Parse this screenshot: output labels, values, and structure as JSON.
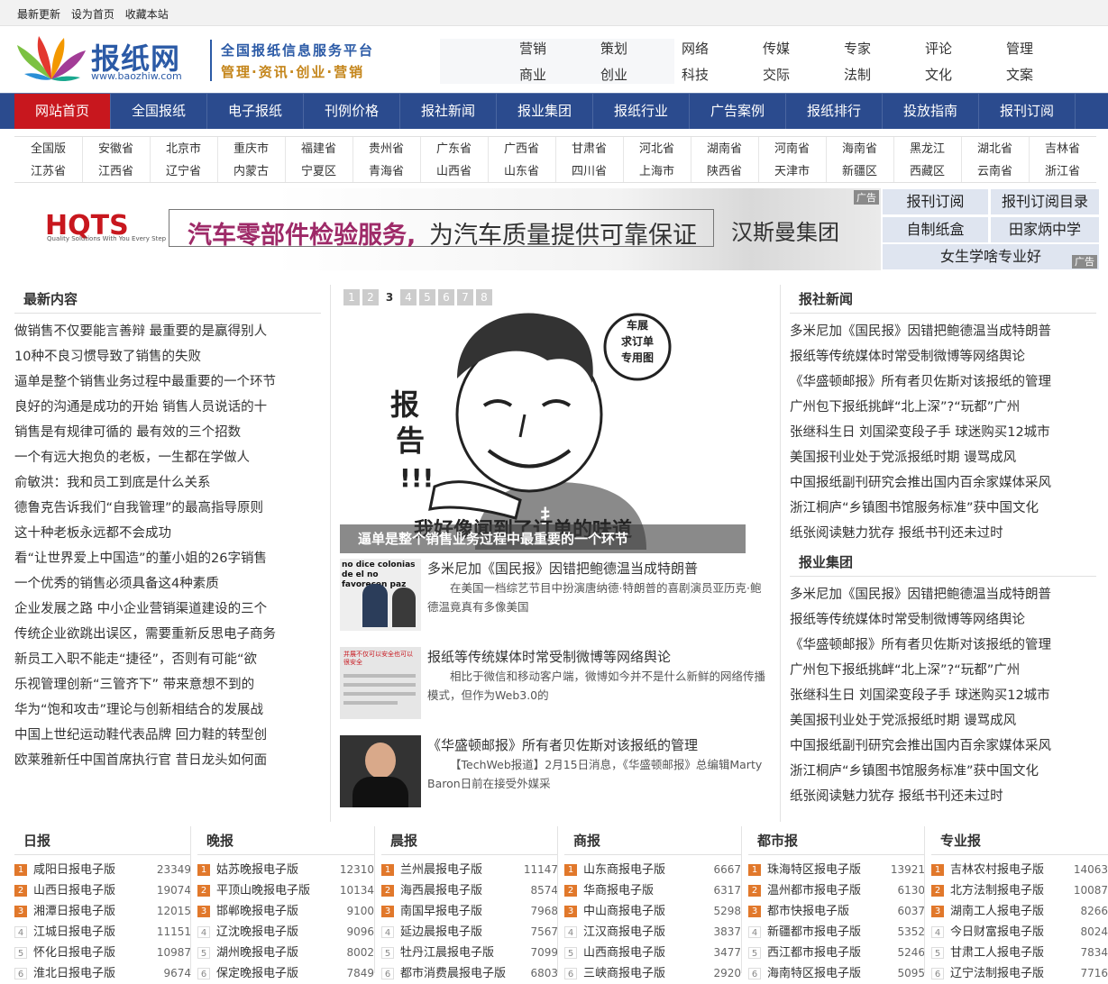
{
  "topbar": {
    "links": [
      "最新更新",
      "设为首页",
      "收藏本站"
    ]
  },
  "logo": {
    "name": "报纸网",
    "url": "www.baozhiw.com"
  },
  "slogan": {
    "line1": "全国报纸信息服务平台",
    "line2": "管理·资讯·创业·营销"
  },
  "topcats": [
    [
      "营销",
      "策划",
      "网络",
      "传媒",
      "专家",
      "评论",
      "管理"
    ],
    [
      "商业",
      "创业",
      "科技",
      "交际",
      "法制",
      "文化",
      "文案"
    ]
  ],
  "nav": [
    "网站首页",
    "全国报纸",
    "电子报纸",
    "刊例价格",
    "报社新闻",
    "报业集团",
    "报纸行业",
    "广告案例",
    "报纸排行",
    "投放指南",
    "报刊订阅"
  ],
  "regions": [
    [
      "全国版",
      "安徽省",
      "北京市",
      "重庆市",
      "福建省",
      "贵州省",
      "广东省",
      "广西省",
      "甘肃省",
      "河北省",
      "湖南省",
      "河南省",
      "海南省",
      "黑龙江",
      "湖北省",
      "吉林省"
    ],
    [
      "江苏省",
      "江西省",
      "辽宁省",
      "内蒙古",
      "宁夏区",
      "青海省",
      "山西省",
      "山东省",
      "四川省",
      "上海市",
      "陕西省",
      "天津市",
      "新疆区",
      "西藏区",
      "云南省",
      "浙江省"
    ]
  ],
  "banner": {
    "brand": "HQTS",
    "brand_sub": "Quality Solutions With You Every Step",
    "text1": "汽车零部件检验服务,",
    "text2": "为汽车质量提供可靠保证",
    "text3": "汉斯曼集团",
    "ad": "广告"
  },
  "sidead": {
    "items": [
      "报刊订阅",
      "报刊订阅目录",
      "自制纸盒",
      "田家炳中学",
      "女生学啥专业好"
    ],
    "ad": "广告"
  },
  "left": {
    "title": "最新内容",
    "items": [
      "做销售不仅要能言善辩 最重要的是赢得别人",
      "10种不良习惯导致了销售的失败",
      "逼单是整个销售业务过程中最重要的一个环节",
      "良好的沟通是成功的开始 销售人员说话的十",
      "销售是有规律可循的 最有效的三个招数",
      "一个有远大抱负的老板，一生都在学做人",
      "俞敏洪：我和员工到底是什么关系",
      "德鲁克告诉我们“自我管理”的最高指导原则",
      "这十种老板永远都不会成功",
      "看“让世界爱上中国造”的董小姐的26字销售",
      "一个优秀的销售必须具备这4种素质",
      "企业发展之路 中小企业营销渠道建设的三个",
      "传统企业欲跳出误区，需要重新反思电子商务",
      "新员工入职不能走“捷径”，否则有可能“欲",
      "乐视管理创新“三管齐下” 带来意想不到的",
      "华为“饱和攻击”理论与创新相结合的发展战",
      "中国上世纪运动鞋代表品牌 回力鞋的转型创",
      "欧莱雅新任中国首席执行官 昔日龙头如何面"
    ]
  },
  "slider": {
    "pages": [
      "1",
      "2",
      "3",
      "4",
      "5",
      "6",
      "7",
      "8"
    ],
    "current": "3",
    "caption": "逼单是整个销售业务过程中最重要的一个环节",
    "img_badge": "车展\n求订单\n专用图",
    "img_left": "报告!!!",
    "img_bottom": "我好像闻到了订单的味道",
    "shirt": "扌"
  },
  "news": [
    {
      "title": "多米尼加《国民报》因错把鲍德温当成特朗普",
      "summary": "在美国一档综艺节目中扮演唐纳德·特朗普的喜剧演员亚历克·鲍德温竟真有多像美国",
      "img_text": "no dice colonias de el no favorecen paz"
    },
    {
      "title": "报纸等传统媒体时常受制微博等网络舆论",
      "summary": "相比于微信和移动客户端，微博如今并不是什么新鲜的网络传播模式，但作为Web3.0的",
      "img_text": "并展不仅可以安全也可以很安全"
    },
    {
      "title": "《华盛顿邮报》所有者贝佐斯对该报纸的管理",
      "summary": "【TechWeb报道】2月15日消息，《华盛顿邮报》总编辑Marty Baron日前在接受外媒采",
      "img_text": ""
    }
  ],
  "right": {
    "title1": "报社新闻",
    "items1": [
      "多米尼加《国民报》因错把鲍德温当成特朗普",
      "报纸等传统媒体时常受制微博等网络舆论",
      "《华盛顿邮报》所有者贝佐斯对该报纸的管理",
      "广州包下报纸挑衅“北上深”?“玩都”广州",
      "张继科生日 刘国梁变段子手 球迷购买12城市",
      "美国报刊业处于党派报纸时期 谩骂成风",
      "中国报纸副刊研究会推出国内百余家媒体采风",
      "浙江桐庐“乡镇图书馆服务标准”获中国文化",
      "纸张阅读魅力犹存 报纸书刊还未过时"
    ],
    "title2": "报业集团",
    "items2": [
      "多米尼加《国民报》因错把鲍德温当成特朗普",
      "报纸等传统媒体时常受制微博等网络舆论",
      "《华盛顿邮报》所有者贝佐斯对该报纸的管理",
      "广州包下报纸挑衅“北上深”?“玩都”广州",
      "张继科生日 刘国梁变段子手 球迷购买12城市",
      "美国报刊业处于党派报纸时期 谩骂成风",
      "中国报纸副刊研究会推出国内百余家媒体采风",
      "浙江桐庐“乡镇图书馆服务标准”获中国文化",
      "纸张阅读魅力犹存 报纸书刊还未过时"
    ]
  },
  "rankings": [
    {
      "title": "日报",
      "rows": [
        [
          "1",
          "咸阳日报电子版",
          "23349"
        ],
        [
          "2",
          "山西日报电子版",
          "19074"
        ],
        [
          "3",
          "湘潭日报电子版",
          "12015"
        ],
        [
          "4",
          "江城日报电子版",
          "11151"
        ],
        [
          "5",
          "怀化日报电子版",
          "10987"
        ],
        [
          "6",
          "淮北日报电子版",
          "9674"
        ]
      ]
    },
    {
      "title": "晚报",
      "rows": [
        [
          "1",
          "姑苏晚报电子版",
          "12310"
        ],
        [
          "2",
          "平顶山晚报电子版",
          "10134"
        ],
        [
          "3",
          "邯郸晚报电子版",
          "9100"
        ],
        [
          "4",
          "辽沈晚报电子版",
          "9096"
        ],
        [
          "5",
          "湖州晚报电子版",
          "8002"
        ],
        [
          "6",
          "保定晚报电子版",
          "7849"
        ]
      ]
    },
    {
      "title": "晨报",
      "rows": [
        [
          "1",
          "兰州晨报电子版",
          "11147"
        ],
        [
          "2",
          "海西晨报电子版",
          "8574"
        ],
        [
          "3",
          "南国早报电子版",
          "7968"
        ],
        [
          "4",
          "延边晨报电子版",
          "7567"
        ],
        [
          "5",
          "牡丹江晨报电子版",
          "7099"
        ],
        [
          "6",
          "都市消费晨报电子版",
          "6803"
        ]
      ]
    },
    {
      "title": "商报",
      "rows": [
        [
          "1",
          "山东商报电子版",
          "6667"
        ],
        [
          "2",
          "华商报电子版",
          "6317"
        ],
        [
          "3",
          "中山商报电子版",
          "5298"
        ],
        [
          "4",
          "江汉商报电子版",
          "3837"
        ],
        [
          "5",
          "山西商报电子版",
          "3477"
        ],
        [
          "6",
          "三峡商报电子版",
          "2920"
        ]
      ]
    },
    {
      "title": "都市报",
      "rows": [
        [
          "1",
          "珠海特区报电子版",
          "13921"
        ],
        [
          "2",
          "温州都市报电子版",
          "6130"
        ],
        [
          "3",
          "都市快报电子版",
          "6037"
        ],
        [
          "4",
          "新疆都市报电子版",
          "5352"
        ],
        [
          "5",
          "西江都市报电子版",
          "5246"
        ],
        [
          "6",
          "海南特区报电子版",
          "5095"
        ]
      ]
    },
    {
      "title": "专业报",
      "rows": [
        [
          "1",
          "吉林农村报电子版",
          "14063"
        ],
        [
          "2",
          "北方法制报电子版",
          "10087"
        ],
        [
          "3",
          "湖南工人报电子版",
          "8266"
        ],
        [
          "4",
          "今日财富报电子版",
          "8024"
        ],
        [
          "5",
          "甘肃工人报电子版",
          "7834"
        ],
        [
          "6",
          "辽宁法制报电子版",
          "7716"
        ]
      ]
    }
  ]
}
